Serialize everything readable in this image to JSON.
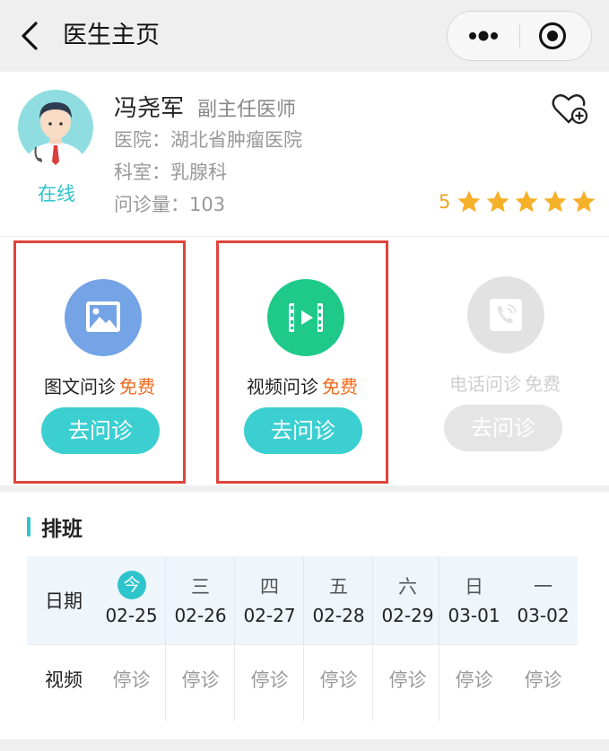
{
  "nav": {
    "title": "医生主页"
  },
  "doctor": {
    "name": "冯尧军",
    "title": "副主任医师",
    "hospital": "医院：湖北省肿瘤医院",
    "department": "科室：乳腺科",
    "consult_count": "问诊量：103",
    "status": "在线",
    "rating": "5",
    "stars": 5
  },
  "consult": [
    {
      "label": "图文问诊",
      "price": "免费",
      "button": "去问诊",
      "icon": "image-icon",
      "color": "#74a3e6",
      "available": true
    },
    {
      "label": "视频问诊",
      "price": "免费",
      "button": "去问诊",
      "icon": "video-icon",
      "color": "#1ec98a",
      "available": true
    },
    {
      "label": "电话问诊",
      "price": "免费",
      "button": "去问诊",
      "icon": "phone-icon",
      "color": "#e2e2e2",
      "available": false
    }
  ],
  "schedule": {
    "title": "排班",
    "date_label": "日期",
    "row_label": "视频",
    "days": [
      {
        "weekday": "今",
        "date": "02-25",
        "status": "停诊"
      },
      {
        "weekday": "三",
        "date": "02-26",
        "status": "停诊"
      },
      {
        "weekday": "四",
        "date": "02-27",
        "status": "停诊"
      },
      {
        "weekday": "五",
        "date": "02-28",
        "status": "停诊"
      },
      {
        "weekday": "六",
        "date": "02-29",
        "status": "停诊"
      },
      {
        "weekday": "日",
        "date": "03-01",
        "status": "停诊"
      },
      {
        "weekday": "一",
        "date": "03-02",
        "status": "停诊"
      }
    ]
  },
  "colors": {
    "accent": "#2ec4cc",
    "highlight": "#e0443b",
    "free": "#f06a1c",
    "star": "#f6b12b"
  }
}
